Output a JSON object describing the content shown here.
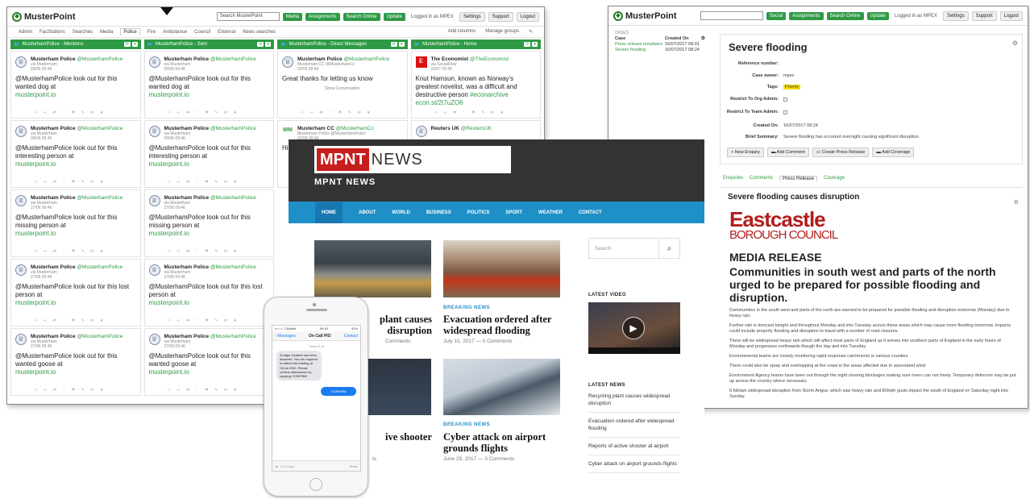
{
  "musterpoint_main": {
    "brand": "MusterPoint",
    "search_placeholder": "Search MusterPoint",
    "nav_buttons": [
      "Media",
      "Assignments",
      "Search Online",
      "Update"
    ],
    "logged_in": "Logged in as MPEX",
    "right_buttons": [
      "Settings",
      "Support",
      "Logout"
    ],
    "tabs": [
      "Admin",
      "FacStations",
      "Searches",
      "Media",
      "Police",
      "Fire",
      "Ambulance",
      "Council",
      "External",
      "News searches"
    ],
    "active_tab": "Police",
    "tab_actions": [
      "Add columns",
      "Manage groups"
    ],
    "columns": [
      {
        "title": "MusterhamPolice - Mentions",
        "tweets": [
          {
            "name": "Musterham Police",
            "handle": "@MusterhamPolice",
            "via": "via Musterham",
            "date": "09/06 09:46",
            "text": "@MusterhamPolice look out for this wanted dog at",
            "link": "musterpoint.io"
          },
          {
            "name": "Musterham Police",
            "handle": "@MusterhamPolice",
            "via": "via Musterham",
            "date": "09/06 09:46",
            "text": "@MusterhamPolice look out for this interesting person at",
            "link": "musterpoint.io"
          },
          {
            "name": "Musterham Police",
            "handle": "@MusterhamPolice",
            "via": "via Musterham",
            "date": "27/06 09:46",
            "text": "@MusterhamPolice look out for this missing person at",
            "link": "musterpoint.io"
          },
          {
            "name": "Musterham Police",
            "handle": "@MusterhamPolice",
            "via": "via Musterham",
            "date": "27/06 09:46",
            "text": "@MusterhamPolice look out for this lost person at",
            "link": "musterpoint.io"
          },
          {
            "name": "Musterham Police",
            "handle": "@MusterhamPolice",
            "via": "via Musterham",
            "date": "27/06 09:46",
            "text": "@MusterhamPolice look out for this wanted goose at",
            "link": "musterpoint.io"
          }
        ]
      },
      {
        "title": "MusterhamPolice - Sent",
        "tweets": [
          {
            "name": "Musterham Police",
            "handle": "@MusterhamPolice",
            "via": "via Musterham",
            "date": "09/06 09:46",
            "text": "@MusterhamPolice look out for this wanted dog at",
            "link": "musterpoint.io"
          },
          {
            "name": "Musterham Police",
            "handle": "@MusterhamPolice",
            "via": "via Musterham",
            "date": "09/06 09:46",
            "text": "@MusterhamPolice look out for this interesting person at",
            "link": "musterpoint.io"
          },
          {
            "name": "Musterham Police",
            "handle": "@MusterhamPolice",
            "via": "via Musterham",
            "date": "27/06 09:46",
            "text": "@MusterhamPolice look out for this missing person at",
            "link": "musterpoint.io"
          },
          {
            "name": "Musterham Police",
            "handle": "@MusterhamPolice",
            "via": "via Musterham",
            "date": "27/06 09:46",
            "text": "@MusterhamPolice look out for this lost person at",
            "link": "musterpoint.io"
          },
          {
            "name": "Musterham Police",
            "handle": "@MusterhamPolice",
            "via": "via Musterham",
            "date": "27/06 09:46",
            "text": "@MusterhamPolice look out for this wanted goose at",
            "link": "musterpoint.io"
          }
        ]
      },
      {
        "title": "MusterhamPolice - Direct Messages",
        "tweets": [
          {
            "name": "Musterham Police",
            "handle": "@MusterhamPolice",
            "via": "Musterham CC @MusterhamCc",
            "date": "02/06 09:46",
            "text": "Great thanks for letting us know",
            "link": "",
            "extra": "Show Conversation"
          },
          {
            "name": "Musterham CC",
            "handle": "@MusterhamCc",
            "via": "Musterham Police @MusterhamPolice",
            "date": "02/06 09:46",
            "text": "Hi",
            "link": ""
          }
        ]
      },
      {
        "title": "MusterhamPolice - Home",
        "tweets": [
          {
            "name": "The Economist",
            "handle": "@TheEconomist",
            "via": "via SocialFlow",
            "date": "16/07 09:46",
            "text": "Knut Hamsun, known as Norway's greatest novelist, was a difficult and destructive person",
            "hashtag": "#econarchive",
            "link": "econ.st/2t7uZO6"
          },
          {
            "name": "Reuters UK",
            "handle": "@ReutersUK",
            "via": "",
            "date": "",
            "text": "",
            "link": ""
          }
        ]
      }
    ]
  },
  "musterpoint_case": {
    "brand": "MusterPoint",
    "nav_buttons": [
      "Social",
      "Assignments",
      "Search Online",
      "Update"
    ],
    "logged_in": "Logged in as MPEX",
    "right_buttons": [
      "Settings",
      "Support",
      "Logout"
    ],
    "cases_label": "CASES",
    "case_headers": [
      "Case",
      "Created On"
    ],
    "case_rows": [
      {
        "name": "Press release templates",
        "date": "16/07/2017 08:01"
      },
      {
        "name": "Severe flooding",
        "date": "16/07/2017 08:24"
      }
    ],
    "title": "Severe flooding",
    "fields": [
      {
        "label": "Reference number:",
        "value": ""
      },
      {
        "label": "Case owner:",
        "value": "mpex"
      },
      {
        "label": "Tags:",
        "value": "Priority"
      },
      {
        "label": "Restrict To Org Admin:",
        "value": ""
      },
      {
        "label": "Restrict To Team Admin:",
        "value": ""
      },
      {
        "label": "Created On:",
        "value": "16/07/2017 08:24"
      },
      {
        "label": "Brief Summary:",
        "value": "Severe flooding has occurred overnight causing significant disruption."
      }
    ],
    "actions": [
      "New Enquiry",
      "Add Comment",
      "Create Press Release",
      "Add Coverage"
    ],
    "tabs": [
      "Enquiries",
      "Comments",
      "Press Release",
      "Coverage"
    ],
    "active_tab": "Press Release",
    "press_title": "Severe flooding causes disruption",
    "council_line1": "Eastcastle",
    "council_line2": "BOROUGH COUNCIL",
    "media_release": "MEDIA RELEASE",
    "headline": "Communities in south west and parts of the north urged to be prepared for possible flooding and disruption.",
    "paragraphs": [
      "Communities in the south west and parts of the north are warned to be prepared for possible flooding and disruption tomorrow (Monday) due to heavy rain.",
      "Further rain is forecast tonight and throughout Monday and into Tuesday across these areas which may cause more flooding tomorrow. Impacts could include property flooding and disruption to travel with a number of road closures.",
      "There will be widespread heavy rain which will affect most parts of England as it arrives into southern parts of England in the early hours of Monday and progresses northwards though the day and into Tuesday.",
      "Environmental teams are closely monitoring rapid response catchments in various counties.",
      "There could also be spray and overtopping at the coast in the areas affected due to associated wind.",
      "Environment Agency teams have been out through the night clearing blockages making sure rivers can run freely. Temporary defences may be put up across the country where necessary.",
      "It follows widespread disruption from Storm Angus, which saw heavy rain and 80mph gusts impact the south of England on Saturday night into Sunday."
    ]
  },
  "news": {
    "logo_red": "MPNT",
    "logo_word": "NEWS",
    "site_name": "MPNT NEWS",
    "nav": [
      "HOME",
      "ABOUT",
      "WORLD",
      "BUSINESS",
      "POLITICS",
      "SPORT",
      "WEATHER",
      "CONTACT"
    ],
    "articles": [
      {
        "category": "",
        "title": "Recycling plant causes widespread disruption",
        "title_visible": "plant causes disruption",
        "meta": "Comments"
      },
      {
        "category": "BREAKING NEWS",
        "title": "Evacuation ordered after widespread flooding",
        "meta": "July 15, 2017 — 0 Comments"
      },
      {
        "category": "",
        "title": "Reports of active shooter",
        "title_visible": "ive shooter",
        "meta": "ts"
      },
      {
        "category": "BREAKING NEWS",
        "title": "Cyber attack on airport grounds flights",
        "meta": "June 29, 2017 — 0 Comments"
      }
    ],
    "search_placeholder": "Search",
    "latest_video": "LATEST VIDEO",
    "latest_news_label": "LATEST NEWS",
    "latest_news": [
      "Recycling plant causes widespread disruption",
      "Evacuation ordered after widespread flooding",
      "Reports of active shooter at airport",
      "Cyber attack on airport grounds flights"
    ]
  },
  "phone": {
    "carrier": "••○○○ T-Mobile",
    "time": "09:18",
    "battery": "42%",
    "back": "Messages",
    "contact": "On Call PIO",
    "contact_btn": "Contact",
    "date": "Today 09:18",
    "message": "A major incident has been declared. You are required to attend the briefing at HQ at 2200. Please confirm attendance by replying CONFIRM",
    "reply": "CONFIRM",
    "input_placeholder": "iMessage",
    "send": "Send"
  }
}
